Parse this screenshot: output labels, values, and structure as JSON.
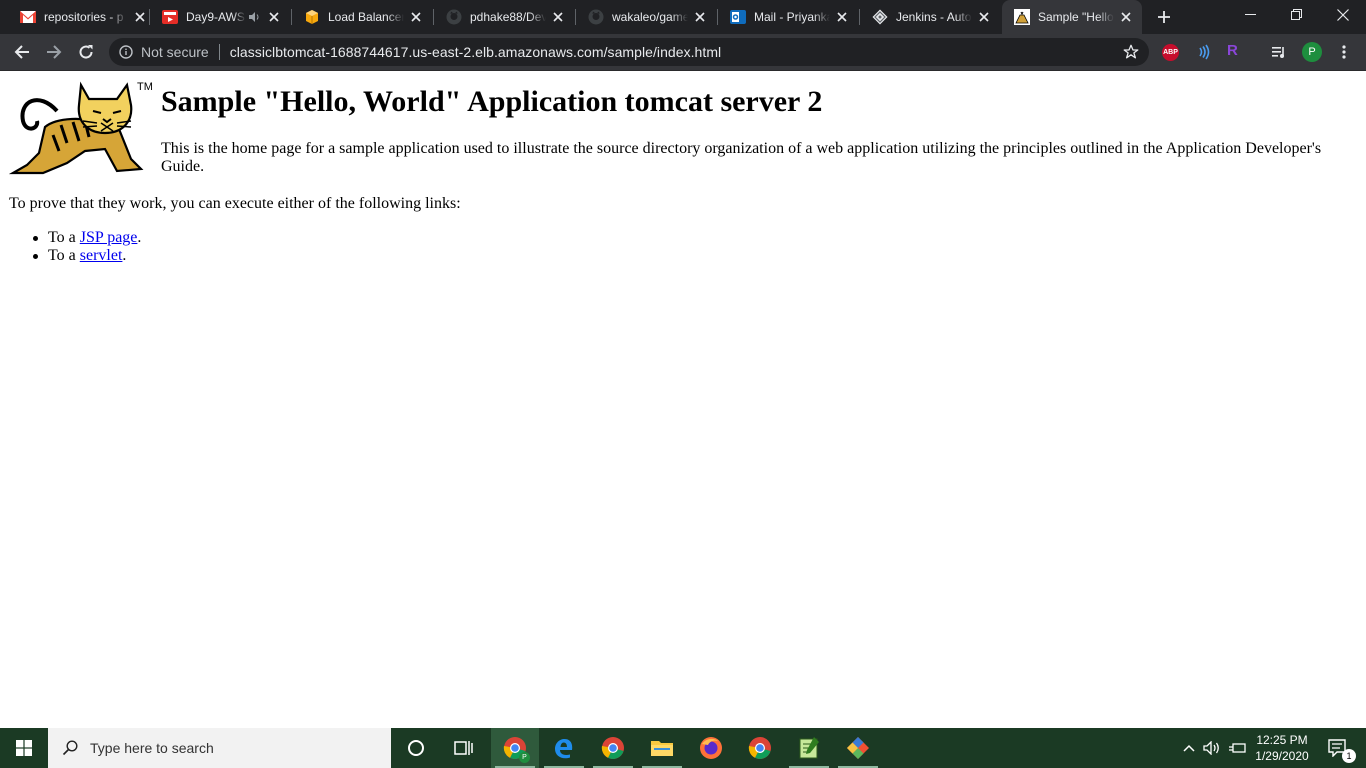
{
  "browser": {
    "tabs": [
      {
        "title": "repositories - p",
        "icon": "gmail-icon"
      },
      {
        "title": "Day9-AWS",
        "icon": "youtube-icon",
        "audio": true
      },
      {
        "title": "Load Balancers",
        "icon": "aws-icon"
      },
      {
        "title": "pdhake88/Dev",
        "icon": "github-icon"
      },
      {
        "title": "wakaleo/game",
        "icon": "github-icon"
      },
      {
        "title": "Mail - Priyanka",
        "icon": "outlook-icon"
      },
      {
        "title": "Jenkins - Auto",
        "icon": "jenkins-icon"
      },
      {
        "title": "Sample \"Hello",
        "icon": "tomcat-icon",
        "active": true
      }
    ],
    "address_bar": {
      "security_label": "Not secure",
      "url": "classiclbtomcat-1688744617.us-east-2.elb.amazonaws.com/sample/index.html"
    },
    "extensions": {
      "abp_label": "ABP",
      "r_label": "R",
      "profile_initial": "P"
    },
    "colors": {
      "tabstrip": "#202124",
      "toolbar": "#35363a",
      "link": "#0000ee"
    }
  },
  "page": {
    "logo_mark": "TM",
    "heading": "Sample \"Hello, World\" Application tomcat server 2",
    "description": "This is the home page for a sample application used to illustrate the source directory organization of a web application utilizing the principles outlined in the Application Developer's Guide.",
    "prove_text": "To prove that they work, you can execute either of the following links:",
    "links": [
      {
        "prefix": "To a ",
        "link": "JSP page",
        "suffix": "."
      },
      {
        "prefix": "To a ",
        "link": "servlet",
        "suffix": "."
      }
    ]
  },
  "taskbar": {
    "search_placeholder": "Type here to search",
    "chrome_badge": "P",
    "time": "12:25 PM",
    "date": "1/29/2020",
    "notification_count": "1",
    "color": "#1b3a24"
  }
}
